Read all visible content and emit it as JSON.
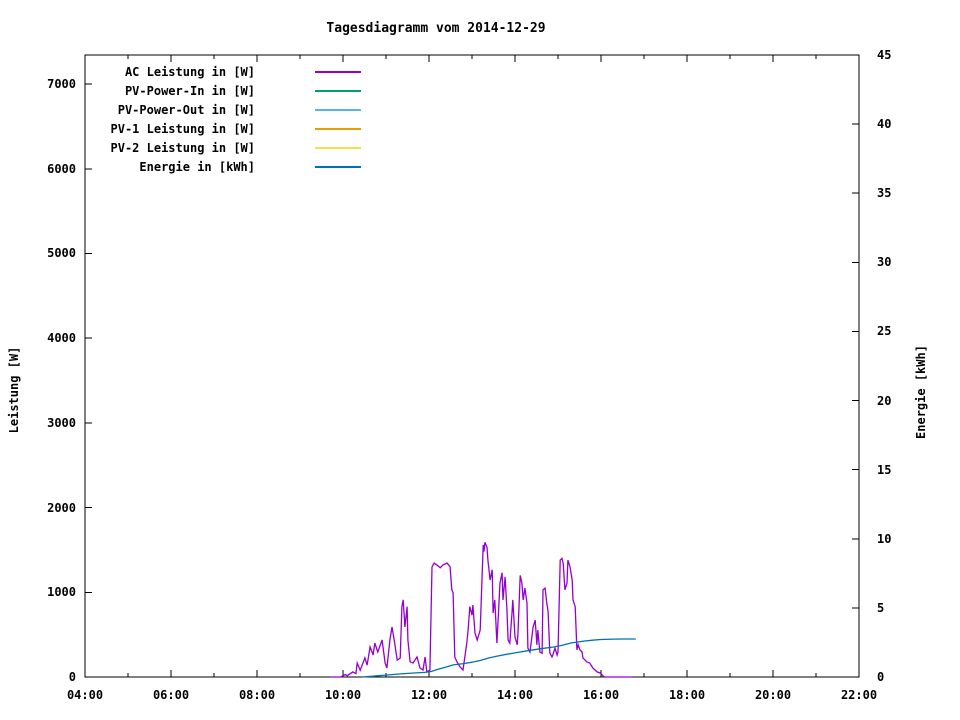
{
  "chart_data": {
    "type": "line",
    "title": "Tagesdiagramm vom 2014-12-29",
    "ylabel_left": "Leistung [W]",
    "ylabel_right": "Energie [kWh]",
    "background_color": "#ffffff",
    "axis_color": "#000000",
    "grid": false,
    "legend_position": "top-left-inside",
    "x_axis": {
      "unit": "time of day",
      "range_hours": [
        4,
        22
      ],
      "ticks_major": [
        {
          "hour": 4,
          "label": "04:00"
        },
        {
          "hour": 6,
          "label": "06:00"
        },
        {
          "hour": 8,
          "label": "08:00"
        },
        {
          "hour": 10,
          "label": "10:00"
        },
        {
          "hour": 12,
          "label": "12:00"
        },
        {
          "hour": 14,
          "label": "14:00"
        },
        {
          "hour": 16,
          "label": "16:00"
        },
        {
          "hour": 18,
          "label": "18:00"
        },
        {
          "hour": 20,
          "label": "20:00"
        },
        {
          "hour": 22,
          "label": "22:00"
        }
      ],
      "ticks_minor_hours": [
        5,
        7,
        9,
        11,
        13,
        15,
        17,
        19,
        21
      ]
    },
    "y_left": {
      "label": "Leistung [W]",
      "range": [
        0,
        7343
      ],
      "ticks": [
        {
          "value": 0,
          "label": "0"
        },
        {
          "value": 1000,
          "label": "1000"
        },
        {
          "value": 2000,
          "label": "2000"
        },
        {
          "value": 3000,
          "label": "3000"
        },
        {
          "value": 4000,
          "label": "4000"
        },
        {
          "value": 5000,
          "label": "5000"
        },
        {
          "value": 6000,
          "label": "6000"
        },
        {
          "value": 7000,
          "label": "7000"
        }
      ]
    },
    "y_right": {
      "label": "Energie [kWh]",
      "range": [
        0,
        45
      ],
      "ticks": [
        {
          "value": 0,
          "label": "0"
        },
        {
          "value": 5,
          "label": "5"
        },
        {
          "value": 10,
          "label": "10"
        },
        {
          "value": 15,
          "label": "15"
        },
        {
          "value": 20,
          "label": "20"
        },
        {
          "value": 25,
          "label": "25"
        },
        {
          "value": 30,
          "label": "30"
        },
        {
          "value": 35,
          "label": "35"
        },
        {
          "value": 40,
          "label": "40"
        },
        {
          "value": 45,
          "label": "45"
        }
      ]
    },
    "series": [
      {
        "name": "AC Leistung in [W]",
        "color": "#9400d3",
        "axis": "left",
        "points": [
          [
            9.7,
            0
          ],
          [
            9.95,
            0
          ],
          [
            10.05,
            30
          ],
          [
            10.1,
            15
          ],
          [
            10.23,
            60
          ],
          [
            10.3,
            40
          ],
          [
            10.33,
            165
          ],
          [
            10.4,
            80
          ],
          [
            10.51,
            225
          ],
          [
            10.56,
            140
          ],
          [
            10.63,
            355
          ],
          [
            10.7,
            260
          ],
          [
            10.74,
            400
          ],
          [
            10.81,
            295
          ],
          [
            10.91,
            437
          ],
          [
            10.98,
            165
          ],
          [
            11.02,
            106
          ],
          [
            11.09,
            437
          ],
          [
            11.14,
            590
          ],
          [
            11.19,
            437
          ],
          [
            11.26,
            200
          ],
          [
            11.33,
            224
          ],
          [
            11.37,
            830
          ],
          [
            11.4,
            910
          ],
          [
            11.44,
            590
          ],
          [
            11.49,
            830
          ],
          [
            11.51,
            437
          ],
          [
            11.56,
            180
          ],
          [
            11.63,
            165
          ],
          [
            11.72,
            236
          ],
          [
            11.79,
            106
          ],
          [
            11.86,
            83
          ],
          [
            11.91,
            236
          ],
          [
            11.95,
            60
          ],
          [
            12.02,
            80
          ],
          [
            12.07,
            1300
          ],
          [
            12.12,
            1345
          ],
          [
            12.19,
            1320
          ],
          [
            12.26,
            1290
          ],
          [
            12.33,
            1325
          ],
          [
            12.42,
            1345
          ],
          [
            12.49,
            1300
          ],
          [
            12.53,
            1030
          ],
          [
            12.56,
            995
          ],
          [
            12.6,
            236
          ],
          [
            12.65,
            177
          ],
          [
            12.72,
            120
          ],
          [
            12.79,
            83
          ],
          [
            12.88,
            400
          ],
          [
            12.91,
            555
          ],
          [
            12.95,
            830
          ],
          [
            13.0,
            730
          ],
          [
            13.02,
            850
          ],
          [
            13.07,
            520
          ],
          [
            13.12,
            437
          ],
          [
            13.19,
            555
          ],
          [
            13.26,
            1560
          ],
          [
            13.28,
            1480
          ],
          [
            13.3,
            1590
          ],
          [
            13.35,
            1530
          ],
          [
            13.37,
            1380
          ],
          [
            13.42,
            1145
          ],
          [
            13.47,
            1265
          ],
          [
            13.49,
            755
          ],
          [
            13.53,
            910
          ],
          [
            13.58,
            400
          ],
          [
            13.65,
            1110
          ],
          [
            13.7,
            1230
          ],
          [
            13.72,
            910
          ],
          [
            13.77,
            1180
          ],
          [
            13.81,
            830
          ],
          [
            13.84,
            437
          ],
          [
            13.88,
            400
          ],
          [
            13.93,
            755
          ],
          [
            13.95,
            910
          ],
          [
            14.0,
            470
          ],
          [
            14.05,
            380
          ],
          [
            14.07,
            520
          ],
          [
            14.12,
            1200
          ],
          [
            14.16,
            1110
          ],
          [
            14.19,
            910
          ],
          [
            14.23,
            1050
          ],
          [
            14.28,
            870
          ],
          [
            14.3,
            340
          ],
          [
            14.35,
            295
          ],
          [
            14.42,
            590
          ],
          [
            14.47,
            670
          ],
          [
            14.51,
            380
          ],
          [
            14.53,
            555
          ],
          [
            14.58,
            295
          ],
          [
            14.63,
            280
          ],
          [
            14.65,
            1030
          ],
          [
            14.7,
            1050
          ],
          [
            14.74,
            870
          ],
          [
            14.77,
            770
          ],
          [
            14.81,
            283
          ],
          [
            14.86,
            236
          ],
          [
            14.88,
            260
          ],
          [
            14.93,
            340
          ],
          [
            14.98,
            260
          ],
          [
            15.0,
            295
          ],
          [
            15.05,
            1380
          ],
          [
            15.09,
            1400
          ],
          [
            15.12,
            1345
          ],
          [
            15.16,
            1030
          ],
          [
            15.21,
            1110
          ],
          [
            15.23,
            1380
          ],
          [
            15.28,
            1300
          ],
          [
            15.33,
            1145
          ],
          [
            15.35,
            910
          ],
          [
            15.4,
            830
          ],
          [
            15.44,
            320
          ],
          [
            15.47,
            380
          ],
          [
            15.51,
            320
          ],
          [
            15.56,
            295
          ],
          [
            15.58,
            225
          ],
          [
            15.63,
            200
          ],
          [
            15.67,
            177
          ],
          [
            15.74,
            165
          ],
          [
            15.81,
            106
          ],
          [
            15.91,
            60
          ],
          [
            15.98,
            47
          ],
          [
            16.05,
            12
          ],
          [
            16.09,
            0
          ],
          [
            16.72,
            0
          ]
        ]
      },
      {
        "name": "PV-Power-In in [W]",
        "color": "#009e73",
        "axis": "left",
        "points": [],
        "note": "not visible above baseline in screenshot"
      },
      {
        "name": "PV-Power-Out in [W]",
        "color": "#56b4e9",
        "axis": "left",
        "points": [],
        "note": "not visible above baseline in screenshot"
      },
      {
        "name": "PV-1 Leistung in [W]",
        "color": "#e69f00",
        "axis": "left",
        "points": [],
        "note": "not visible above baseline in screenshot"
      },
      {
        "name": "PV-2 Leistung in [W]",
        "color": "#f0e442",
        "axis": "left",
        "points": [],
        "note": "not visible above baseline in screenshot"
      },
      {
        "name": "Energie in [kWh]",
        "color": "#0072b2",
        "axis": "right",
        "points": [
          [
            10.45,
            0.0
          ],
          [
            10.7,
            0.06
          ],
          [
            11.0,
            0.14
          ],
          [
            11.3,
            0.22
          ],
          [
            11.6,
            0.28
          ],
          [
            11.9,
            0.33
          ],
          [
            12.05,
            0.4
          ],
          [
            12.2,
            0.55
          ],
          [
            12.4,
            0.72
          ],
          [
            12.55,
            0.87
          ],
          [
            12.8,
            0.97
          ],
          [
            13.0,
            1.07
          ],
          [
            13.2,
            1.2
          ],
          [
            13.4,
            1.38
          ],
          [
            13.6,
            1.52
          ],
          [
            13.8,
            1.64
          ],
          [
            14.0,
            1.74
          ],
          [
            14.3,
            1.9
          ],
          [
            14.6,
            2.05
          ],
          [
            14.9,
            2.17
          ],
          [
            15.1,
            2.3
          ],
          [
            15.3,
            2.46
          ],
          [
            15.6,
            2.6
          ],
          [
            15.8,
            2.66
          ],
          [
            16.0,
            2.71
          ],
          [
            16.3,
            2.74
          ],
          [
            16.5,
            2.75
          ],
          [
            16.81,
            2.75
          ]
        ]
      }
    ]
  }
}
